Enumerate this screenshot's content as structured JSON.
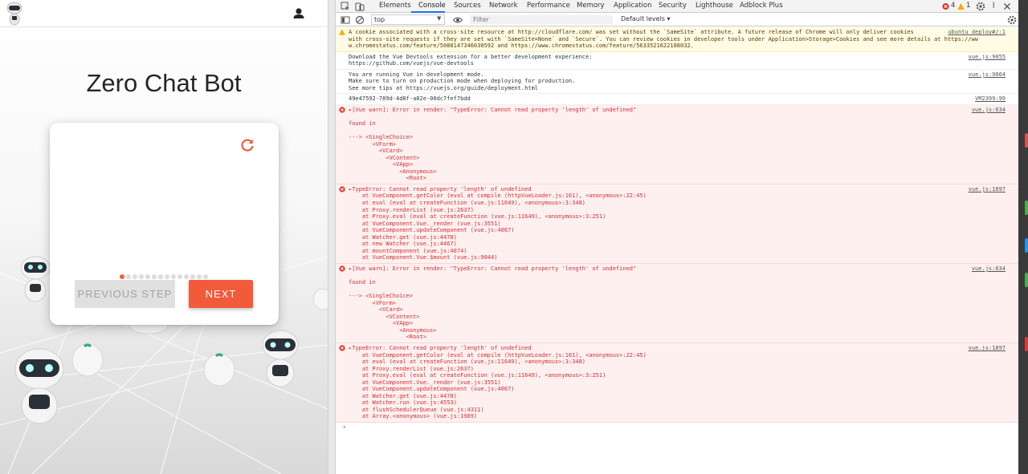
{
  "app": {
    "title": "Zero Chat Bot",
    "prev_label": "PREVIOUS STEP",
    "next_label": "NEXT",
    "progress": {
      "current_step": 1,
      "total_steps": 14
    },
    "colors": {
      "accent": "#f25b3a",
      "title": "#262626"
    },
    "icons": {
      "logo": "robot-logo-icon",
      "account": "account-icon",
      "refresh": "refresh-icon"
    }
  },
  "devtools": {
    "tabs": [
      "Elements",
      "Console",
      "Sources",
      "Network",
      "Performance",
      "Memory",
      "Application",
      "Security",
      "Lighthouse",
      "Adblock Plus"
    ],
    "active_tab": "Console",
    "error_count": "4",
    "warning_count": "1",
    "context": "top",
    "filter_placeholder": "Filter",
    "levels_label": "Default levels",
    "messages": {
      "cookie_warning": {
        "lines": [
          "A cookie associated with a cross-site resource at http://cloudflare.com/ was set without the `SameSite` attribute. A future release of Chrome will only deliver cookies",
          "with cross-site requests if they are set with `SameSite=None` and `Secure`. You can review cookies in developer tools under Application>Storage>Cookies and see more details at https://ww",
          "w.chromestatus.com/feature/5088147346030592 and https://www.chromestatus.com/feature/5633521622188032."
        ],
        "source": "ubuntu_deploy#/:1"
      },
      "devtools_info": {
        "lines": [
          "Download the Vue Devtools extension for a better development experience:",
          "https://github.com/vuejs/vue-devtools"
        ],
        "source": "vue.js:9055"
      },
      "dev_mode_info": {
        "lines": [
          "You are running Vue in development mode.",
          "Make sure to turn on production mode when deploying for production.",
          "See more tips at https://vuejs.org/guide/deployment.html"
        ],
        "source": "vue.js:9064"
      },
      "uuid_log": {
        "lines": [
          "49e47592-789d-4d8f-a82e-00dc7fef7bdd"
        ],
        "source": "VM2399:99"
      },
      "vue_warn_1": {
        "lines": [
          "▸[Vue warn]: Error in render: \"TypeError: Cannot read property 'length' of undefined\"",
          "",
          "found in",
          "",
          "---> <SingleChoice>",
          "       <VForm>",
          "         <VCard>",
          "           <VContent>",
          "             <VApp>",
          "               <Anonymous>",
          "                 <Root>"
        ],
        "source": "vue.js:634"
      },
      "type_error_1": {
        "lines": [
          "▸TypeError: Cannot read property 'length' of undefined",
          "    at VueComponent.getColor (eval at compile (httpVueLoader.js:161), <anonymous>:22:45)",
          "    at eval (eval at createFunction (vue.js:11649), <anonymous>:3:348)",
          "    at Proxy.renderList (vue.js:2637)",
          "    at Proxy.eval (eval at createFunction (vue.js:11649), <anonymous>:3:251)",
          "    at VueComponent.Vue._render (vue.js:3551)",
          "    at VueComponent.updateComponent (vue.js:4067)",
          "    at Watcher.get (vue.js:4478)",
          "    at new Watcher (vue.js:4467)",
          "    at mountComponent (vue.js:4074)",
          "    at VueComponent.Vue.$mount (vue.js:9044)"
        ],
        "source": "vue.js:1897"
      },
      "vue_warn_2": {
        "lines": [
          "▸[Vue warn]: Error in render: \"TypeError: Cannot read property 'length' of undefined\"",
          "",
          "found in",
          "",
          "---> <SingleChoice>",
          "       <VForm>",
          "         <VCard>",
          "           <VContent>",
          "             <VApp>",
          "               <Anonymous>",
          "                 <Root>"
        ],
        "source": "vue.js:634"
      },
      "type_error_2": {
        "lines": [
          "▸TypeError: Cannot read property 'length' of undefined",
          "    at VueComponent.getColor (eval at compile (httpVueLoader.js:161), <anonymous>:22:45)",
          "    at eval (eval at createFunction (vue.js:11649), <anonymous>:3:348)",
          "    at Proxy.renderList (vue.js:2637)",
          "    at Proxy.eval (eval at createFunction (vue.js:11649), <anonymous>:3:251)",
          "    at VueComponent.Vue._render (vue.js:3551)",
          "    at VueComponent.updateComponent (vue.js:4067)",
          "    at Watcher.get (vue.js:4478)",
          "    at Watcher.run (vue.js:4553)",
          "    at flushSchedulerQueue (vue.js:4311)",
          "    at Array.<anonymous> (vue.js:1989)"
        ],
        "source": "vue.js:1897"
      }
    },
    "prompt": "›",
    "colors": {
      "error": "#d32f2f",
      "warning_bg": "#fffbe5",
      "error_bg": "#fff0f0",
      "accent": "#1a73e8"
    }
  }
}
